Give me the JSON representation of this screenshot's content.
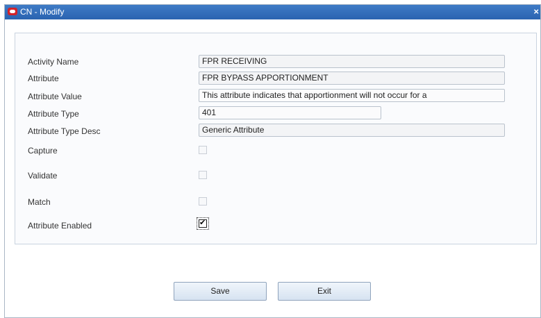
{
  "window": {
    "title": "CN - Modify",
    "close_glyph": "×"
  },
  "form": {
    "activity_name": {
      "label": "Activity Name",
      "value": "FPR RECEIVING"
    },
    "attribute": {
      "label": "Attribute",
      "value": "FPR BYPASS APPORTIONMENT"
    },
    "attribute_value": {
      "label": "Attribute Value",
      "value": "This attribute indicates that apportionment will not occur for a"
    },
    "attribute_type": {
      "label": "Attribute Type",
      "value": "401"
    },
    "attribute_type_desc": {
      "label": "Attribute Type Desc",
      "value": "Generic Attribute"
    },
    "capture": {
      "label": "Capture",
      "checked": false
    },
    "validate": {
      "label": "Validate",
      "checked": false
    },
    "match": {
      "label": "Match",
      "checked": false
    },
    "attribute_enabled": {
      "label": "Attribute Enabled",
      "checked": true
    }
  },
  "buttons": {
    "save": "Save",
    "exit": "Exit"
  }
}
